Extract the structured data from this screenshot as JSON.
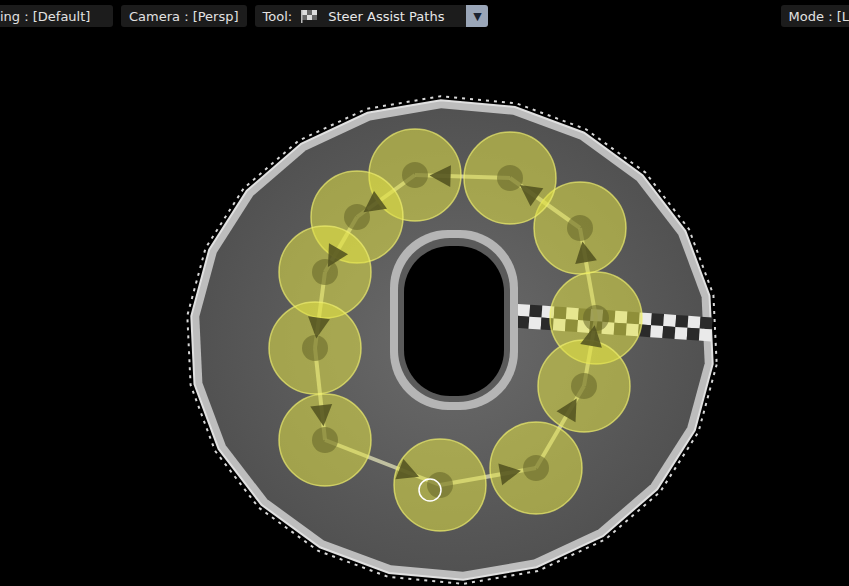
{
  "toolbar": {
    "items": [
      {
        "label": "ing : [Default]"
      },
      {
        "label": "Camera : [Persp]"
      }
    ],
    "tool": {
      "label": "Tool:",
      "value": "Steer Assist Paths",
      "dropdown": "▼"
    },
    "mode": {
      "label": "Mode : [L"
    }
  },
  "scene": {
    "path_nodes": [
      {
        "selected": false
      },
      {
        "selected": false
      },
      {
        "selected": false
      },
      {
        "selected": false
      },
      {
        "selected": false
      },
      {
        "selected": false
      },
      {
        "selected": false
      },
      {
        "selected": false
      },
      {
        "selected": false
      },
      {
        "selected": false
      },
      {
        "selected": false
      }
    ]
  }
}
